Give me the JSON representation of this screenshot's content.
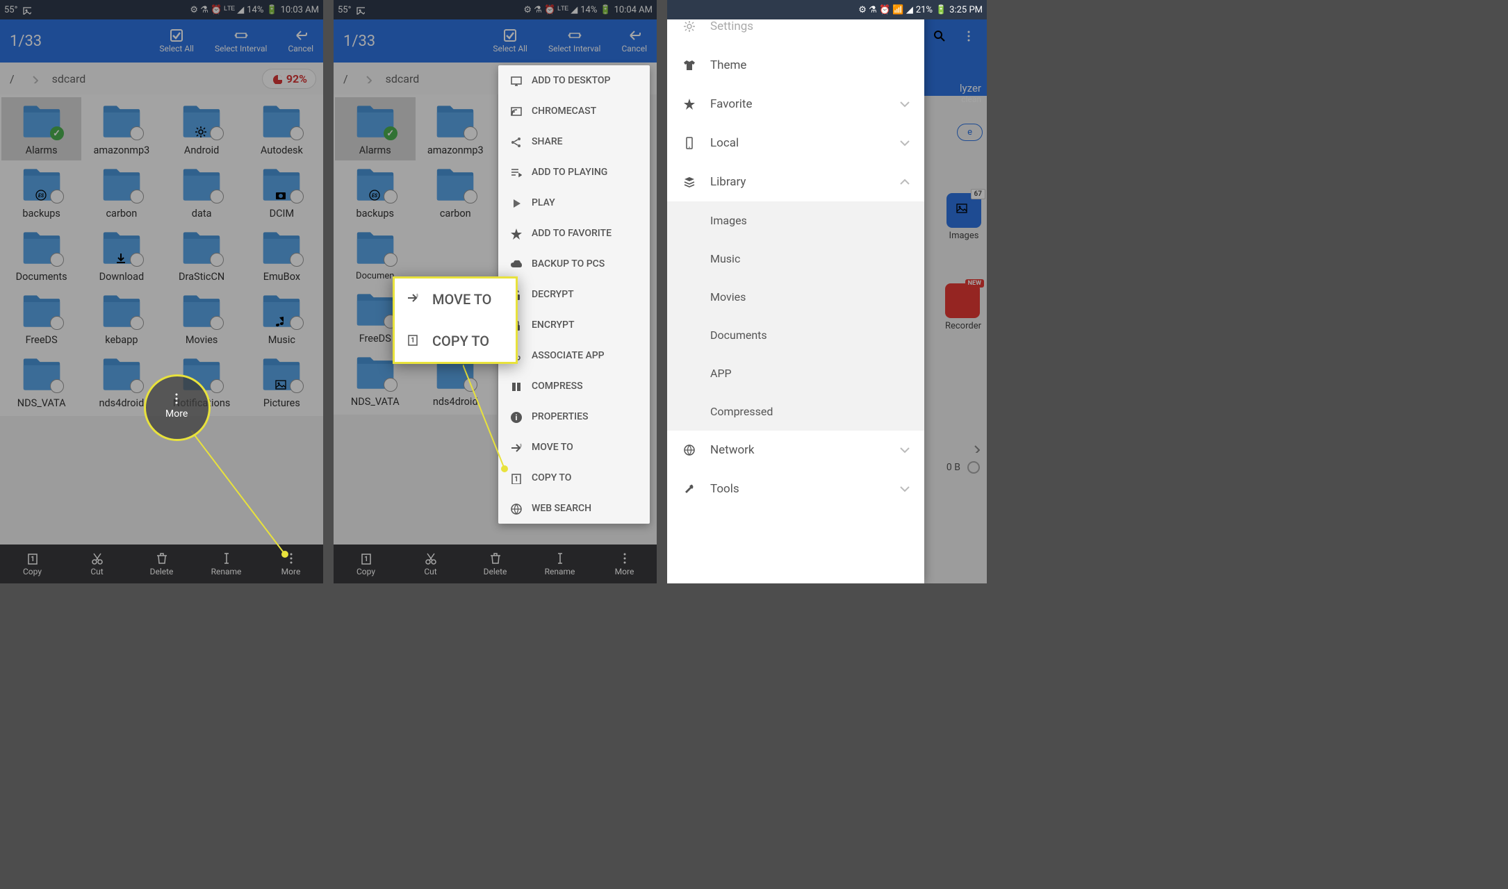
{
  "status": {
    "temp": "55°",
    "battery1": "14%",
    "time1": "10:03 AM",
    "time2": "10:04 AM",
    "battery3": "21%",
    "time3": "3:25 PM"
  },
  "header": {
    "count": "1/33",
    "select_all": "Select All",
    "select_interval": "Select Interval",
    "cancel": "Cancel"
  },
  "breadcrumb": {
    "root": "/",
    "sdcard": "sdcard",
    "disk": "92%"
  },
  "folders": {
    "alarms": "Alarms",
    "amazonmp3": "amazonmp3",
    "android": "Android",
    "autodesk": "Autodesk",
    "backups": "backups",
    "carbon": "carbon",
    "data": "data",
    "dcim": "DCIM",
    "documents": "Documents",
    "download": "Download",
    "drasticcn": "DraSticCN",
    "emubox": "EmuBox",
    "freeds": "FreeDS",
    "kebapp": "kebapp",
    "movies": "Movies",
    "music": "Music",
    "nds_vata": "NDS_VATA",
    "nds4droid": "nds4droid",
    "notifications": "Notifications",
    "pictures": "Pictures"
  },
  "bottom": {
    "copy": "Copy",
    "cut": "Cut",
    "delete": "Delete",
    "rename": "Rename",
    "more": "More"
  },
  "menu": {
    "add_desktop": "ADD TO DESKTOP",
    "chromecast": "CHROMECAST",
    "share": "SHARE",
    "add_playing": "ADD TO PLAYING",
    "play": "PLAY",
    "add_favorite": "ADD TO FAVORITE",
    "backup_pcs": "BACKUP TO PCS",
    "decrypt": "DECRYPT",
    "encrypt": "ENCRYPT",
    "associate": "ASSOCIATE APP",
    "compress": "COMPRESS",
    "properties": "PROPERTIES",
    "move_to": "MOVE TO",
    "copy_to": "COPY TO",
    "web_search": "WEB SEARCH"
  },
  "drawer": {
    "settings": "Settings",
    "theme": "Theme",
    "favorite": "Favorite",
    "local": "Local",
    "library": "Library",
    "images": "Images",
    "music": "Music",
    "movies": "Movies",
    "documents": "Documents",
    "app": "APP",
    "compressed": "Compressed",
    "network": "Network",
    "tools": "Tools"
  },
  "bg3": {
    "analyzer": "lyzer",
    "clean": "clean",
    "images": "Images",
    "images_count": "67",
    "recorder": "Recorder",
    "new": "NEW",
    "size": "0 B"
  }
}
